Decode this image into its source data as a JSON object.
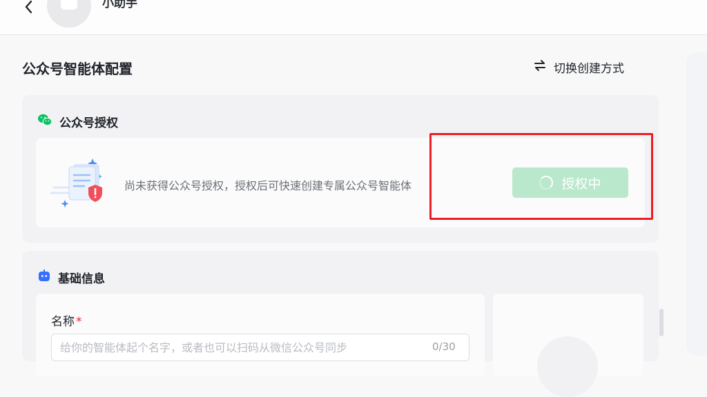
{
  "header": {
    "agent_name": "小助手",
    "back_icon": "chevron-left-icon",
    "avatar_icon": "robot-avatar-icon"
  },
  "page": {
    "title": "公众号智能体配置",
    "switch_mode_label": "切换创建方式",
    "switch_icon": "swap-arrows-icon"
  },
  "auth_section": {
    "title": "公众号授权",
    "icon": "wechat-icon",
    "brand_color": "#07c160",
    "message": "尚未获得公众号授权，授权后可快速创建专属公众号智能体",
    "button_label": "授权中",
    "button_state": "loading",
    "button_color": "#b9e8cc"
  },
  "basic_section": {
    "title": "基础信息",
    "icon": "robot-icon",
    "icon_color": "#3370ff",
    "name_field": {
      "label": "名称",
      "required_mark": "*",
      "placeholder": "给你的智能体起个名字，或者也可以扫码从微信公众号同步",
      "value": "",
      "counter": "0/30"
    }
  },
  "annotation": {
    "highlight_color": "#ec1c24"
  }
}
